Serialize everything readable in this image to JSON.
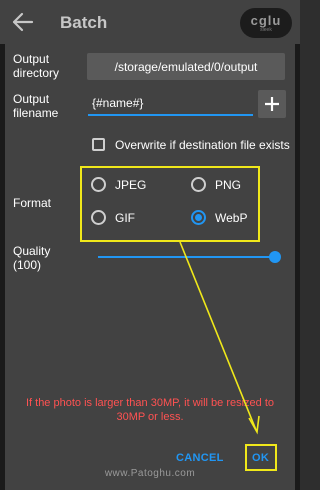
{
  "appbar": {
    "title": "Batch",
    "logo_text": "cglu",
    "logo_sub": "sleek"
  },
  "dialog": {
    "output_directory": {
      "label": "Output\ndirectory",
      "value": "/storage/emulated/0/output"
    },
    "output_filename": {
      "label": "Output\nfilename",
      "value": "{#name#}",
      "add_label": "+"
    },
    "overwrite": {
      "label": "Overwrite if destination file exists",
      "checked": false
    },
    "format": {
      "label": "Format",
      "options": [
        "JPEG",
        "PNG",
        "GIF",
        "WebP"
      ],
      "selected": "WebP"
    },
    "quality": {
      "label": "Quality\n(100)",
      "value": 100
    },
    "warning": "If the photo is larger than 30MP, it will be resized to 30MP or less.",
    "buttons": {
      "cancel": "CANCEL",
      "ok": "OK"
    }
  },
  "watermark": "www.Patoghu.com",
  "colors": {
    "accent": "#2196f3",
    "highlight": "#f0e81a",
    "warning": "#ff5252",
    "dialog_bg": "#424242"
  },
  "icons": {
    "back": "arrow-left-icon",
    "add": "plus-icon"
  }
}
